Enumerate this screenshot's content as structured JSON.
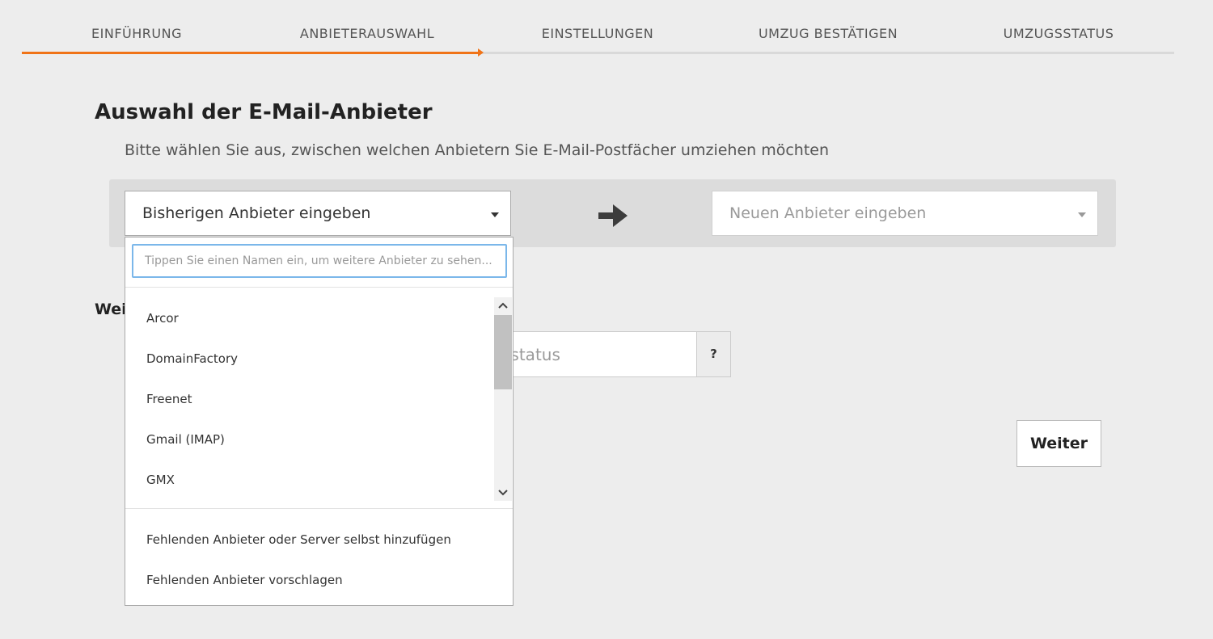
{
  "steps": [
    "EINFÜHRUNG",
    "ANBIETERAUSWAHL",
    "EINSTELLUNGEN",
    "UMZUG BESTÄTIGEN",
    "UMZUGSSTATUS"
  ],
  "progress_fraction": 0.4,
  "accent_color": "#f07317",
  "page_title": "Auswahl der E-Mail-Anbieter",
  "subtitle": "Bitte wählen Sie aus, zwischen welchen Anbietern Sie E-Mail-Postfächer umziehen möchten",
  "source_select": {
    "value": "Bisherigen Anbieter eingeben"
  },
  "target_select": {
    "placeholder": "Neuen Anbieter eingeben"
  },
  "dropdown": {
    "search_placeholder": "Tippen Sie einen Namen ein, um weitere Anbieter zu sehen...",
    "options": [
      "Arcor",
      "DomainFactory",
      "Freenet",
      "Gmail (IMAP)",
      "GMX"
    ],
    "actions": [
      "Fehlenden Anbieter oder Server selbst hinzufügen",
      "Fehlenden Anbieter vorschlagen"
    ]
  },
  "background": {
    "heading_fragment": "Weit",
    "status_placeholder_fragment": "sstatus",
    "help_label": "?",
    "next_button": "Weiter"
  },
  "icons": [
    "arrow-right-icon",
    "caret-down-icon",
    "chevron-up-icon",
    "chevron-down-icon"
  ]
}
